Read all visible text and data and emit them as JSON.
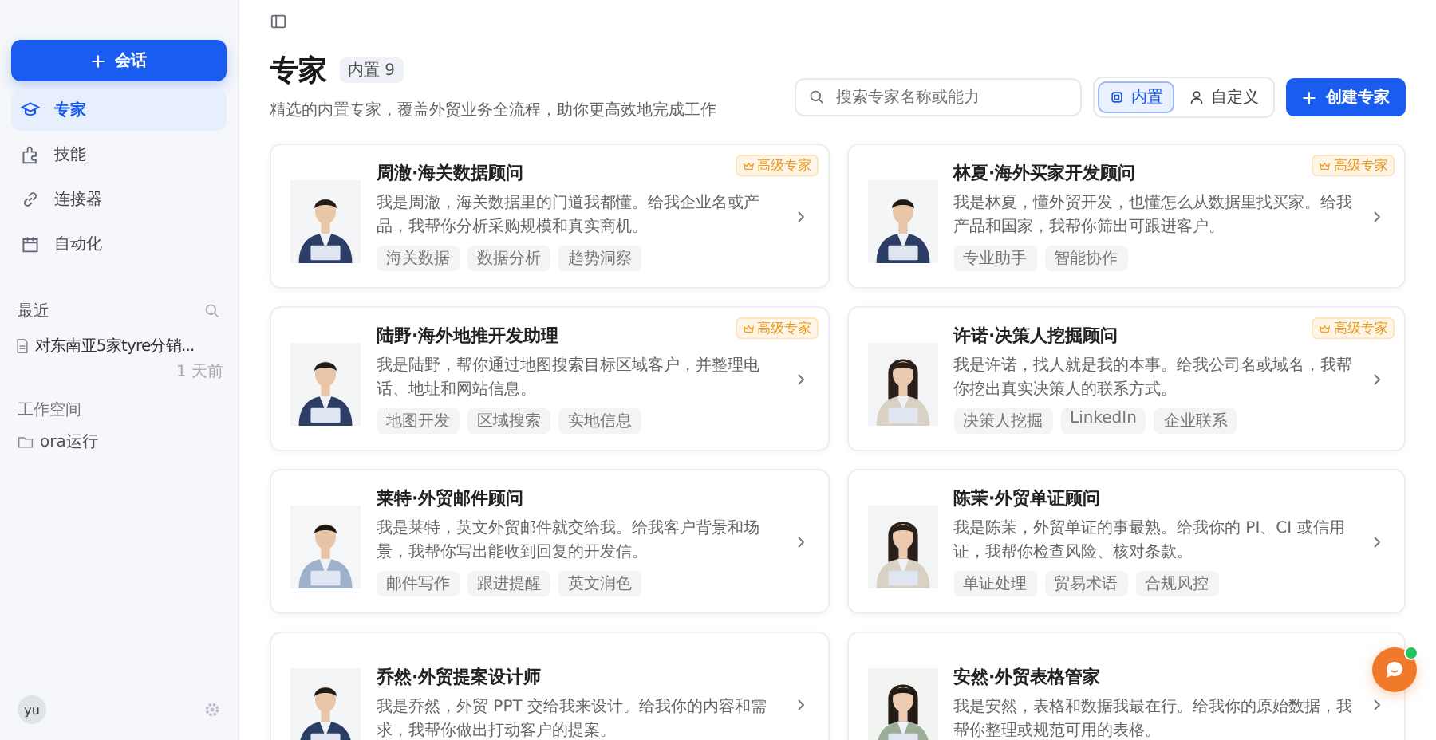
{
  "sidebar": {
    "new_button": "会话",
    "nav": [
      {
        "label": "专家",
        "selected": true
      },
      {
        "label": "技能",
        "selected": false
      },
      {
        "label": "连接器",
        "selected": false
      },
      {
        "label": "自动化",
        "selected": false
      }
    ],
    "recent": {
      "title": "最近",
      "items": [
        {
          "title": "对东南亚5家tyre分销...",
          "time": "1 天前"
        }
      ]
    },
    "workspace": {
      "title": "工作空间",
      "items": [
        {
          "label": "ora运行"
        }
      ]
    },
    "user": {
      "avatar": "yu"
    }
  },
  "header": {
    "title": "专家",
    "count_badge": "内置 9",
    "subtitle": "精选的内置专家，覆盖外贸业务全流程，助你更高效地完成工作",
    "search": {
      "placeholder": "搜索专家名称或能力"
    },
    "filters": [
      {
        "label": "内置",
        "selected": true
      },
      {
        "label": "自定义",
        "selected": false
      }
    ],
    "create_button": "创建专家"
  },
  "experts": [
    {
      "name": "周澈·海关数据顾问",
      "badge": "高级专家",
      "description": "我是周澈，海关数据里的门道我都懂。给我企业名或产品，我帮你分析采购规模和真实商机。",
      "tags": [
        "海关数据",
        "数据分析",
        "趋势洞察"
      ]
    },
    {
      "name": "林夏·海外买家开发顾问",
      "badge": "高级专家",
      "description": "我是林夏，懂外贸开发，也懂怎么从数据里找买家。给我产品和国家，我帮你筛出可跟进客户。",
      "tags": [
        "专业助手",
        "智能协作"
      ]
    },
    {
      "name": "陆野·海外地推开发助理",
      "badge": "高级专家",
      "description": "我是陆野，帮你通过地图搜索目标区域客户，并整理电话、地址和网站信息。",
      "tags": [
        "地图开发",
        "区域搜索",
        "实地信息"
      ]
    },
    {
      "name": "许诺·决策人挖掘顾问",
      "badge": "高级专家",
      "description": "我是许诺，找人就是我的本事。给我公司名或域名，我帮你挖出真实决策人的联系方式。",
      "tags": [
        "决策人挖掘",
        "LinkedIn",
        "企业联系"
      ]
    },
    {
      "name": "莱特·外贸邮件顾问",
      "description": "我是莱特，英文外贸邮件就交给我。给我客户背景和场景，我帮你写出能收到回复的开发信。",
      "tags": [
        "邮件写作",
        "跟进提醒",
        "英文润色"
      ]
    },
    {
      "name": "陈茉·外贸单证顾问",
      "description": "我是陈茉，外贸单证的事最熟。给我你的 PI、CI 或信用证，我帮你检查风险、核对条款。",
      "tags": [
        "单证处理",
        "贸易术语",
        "合规风控"
      ]
    },
    {
      "name": "乔然·外贸提案设计师",
      "description": "我是乔然，外贸 PPT 交给我来设计。给我你的内容和需求，我帮你做出打动客户的提案。"
    },
    {
      "name": "安然·外贸表格管家",
      "description": "我是安然，表格和数据我最在行。给我你的原始数据，我帮你整理或规范可用的表格。"
    }
  ],
  "chat_widget": {
    "online": true
  }
}
